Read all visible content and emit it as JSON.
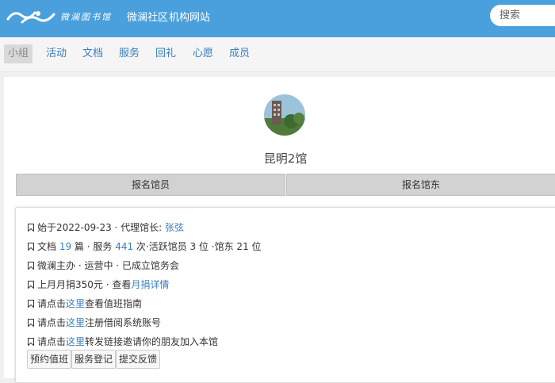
{
  "header": {
    "logo_text": "微澜图书馆",
    "nav": [
      "微澜社区",
      "机构网站"
    ],
    "search_placeholder": "搜索"
  },
  "tabs": [
    {
      "label": "小组",
      "active": true
    },
    {
      "label": "活动",
      "active": false
    },
    {
      "label": "文档",
      "active": false
    },
    {
      "label": "服务",
      "active": false
    },
    {
      "label": "回礼",
      "active": false
    },
    {
      "label": "心愿",
      "active": false
    },
    {
      "label": "成员",
      "active": false
    }
  ],
  "group": {
    "name": "昆明2馆",
    "join_buttons": [
      "报名馆员",
      "报名馆东"
    ]
  },
  "info": {
    "line1": {
      "prefix": "始于2022-09-23 · 代理馆长: ",
      "link": "张弦"
    },
    "line2": {
      "a": "文档 ",
      "docs": "19",
      "b": " 篇 · 服务 ",
      "services": "441",
      "c": " 次·活跃馆员 3 位 ·馆东 21 位"
    },
    "line3": {
      "text": "微澜主办 · 运营中  · 已成立馆务会"
    },
    "line4": {
      "prefix": "上月月捐350元 · 查看",
      "link": "月捐详情"
    },
    "line5": {
      "prefix": "请点击",
      "link": "这里",
      "suffix": "查看值班指南"
    },
    "line6": {
      "prefix": "请点击",
      "link": "这里",
      "suffix": "注册借阅系统账号"
    },
    "line7": {
      "prefix": "请点击",
      "link": "这里",
      "suffix": "转发链接邀请你的朋友加入本馆"
    }
  },
  "actions": [
    "预约值班",
    "服务登记",
    "提交反馈"
  ],
  "colors": {
    "header_bg": "#4aa0dc",
    "link": "#3a7ebc",
    "tab_active_bg": "#d9d9d9"
  }
}
